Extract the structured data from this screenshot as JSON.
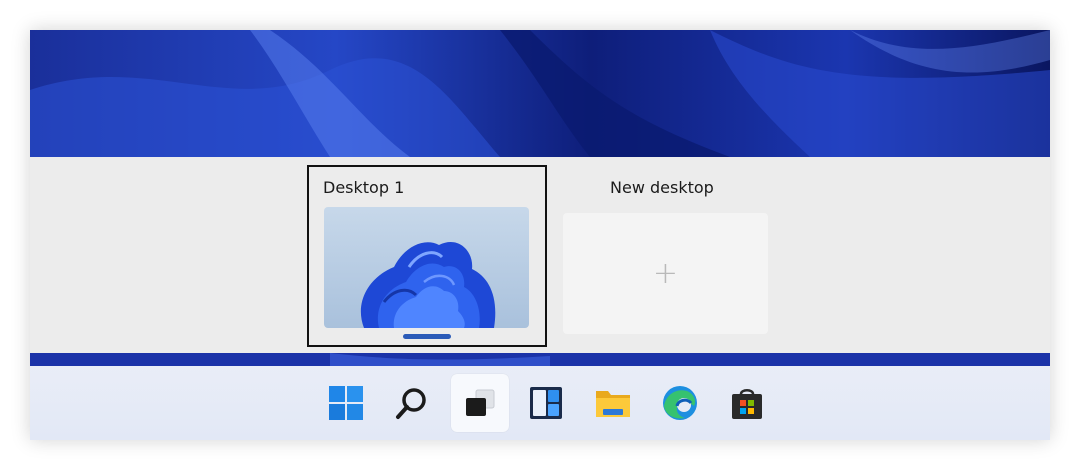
{
  "task_view": {
    "desktops": [
      {
        "label": "Desktop 1",
        "active": true
      }
    ],
    "new_desktop": {
      "label": "New desktop",
      "plus": "+"
    }
  },
  "taskbar": {
    "items": [
      {
        "name": "start-button",
        "icon": "windows-logo-icon"
      },
      {
        "name": "search-button",
        "icon": "search-icon"
      },
      {
        "name": "task-view-button",
        "icon": "task-view-icon",
        "active": true
      },
      {
        "name": "widgets-button",
        "icon": "widgets-icon"
      },
      {
        "name": "file-explorer-button",
        "icon": "folder-icon"
      },
      {
        "name": "edge-button",
        "icon": "edge-icon"
      },
      {
        "name": "store-button",
        "icon": "store-icon"
      }
    ]
  },
  "colors": {
    "wallpaper_dark": "#0b1a6e",
    "wallpaper_mid": "#1e3fbf",
    "switcher_bg": "#ececec",
    "taskbar_bg": "#e6ebf6",
    "active_border": "#111111",
    "indicator": "#2b5bb8"
  }
}
